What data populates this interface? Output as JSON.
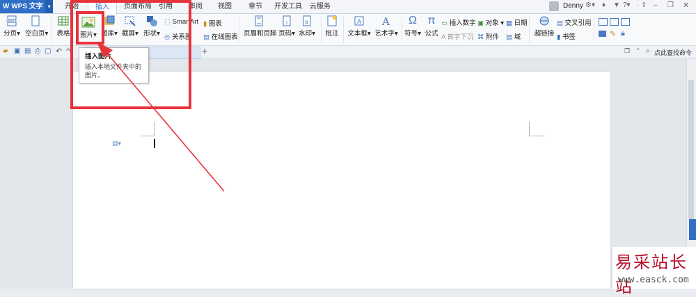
{
  "app": {
    "name": "WPS 文字"
  },
  "tabs": [
    {
      "label": "开始"
    },
    {
      "label": "插入"
    },
    {
      "label": "页面布局"
    },
    {
      "label": "引用"
    },
    {
      "label": "审阅"
    },
    {
      "label": "视图"
    },
    {
      "label": "章节"
    },
    {
      "label": "开发工具"
    },
    {
      "label": "云服务"
    }
  ],
  "user": {
    "name": "Denny"
  },
  "ribbon": {
    "page_break": "分页",
    "blank_page": "空白页",
    "table": "表格",
    "picture": "图片",
    "gallery": "图库",
    "screenshot": "截屏",
    "shapes": "形状",
    "smartart": "SmartArt",
    "chart": "图表",
    "relation": "关系图",
    "online_chart": "在线图表",
    "header_footer": "页眉和页脚",
    "page_number": "页码",
    "watermark": "水印",
    "comment": "批注",
    "textbox": "文本框",
    "wordart": "艺术字",
    "symbol": "符号",
    "formula": "公式",
    "insert_number": "插入数字",
    "object": "对象",
    "date": "日期",
    "drop_cap": "首字下沉",
    "attachment": "附件",
    "field": "域",
    "hyperlink": "超链接",
    "cross_ref": "交叉引用",
    "bookmark": "书签"
  },
  "search": {
    "placeholder": "点此查找命令"
  },
  "tooltip": {
    "title": "插入图片",
    "desc": "插入本地文件夹中的图片。"
  },
  "watermark": {
    "title": "易采站长站",
    "url": "www.easck.com"
  },
  "colors": {
    "accent": "#2f6fc8",
    "highlight": "#e8333b"
  }
}
